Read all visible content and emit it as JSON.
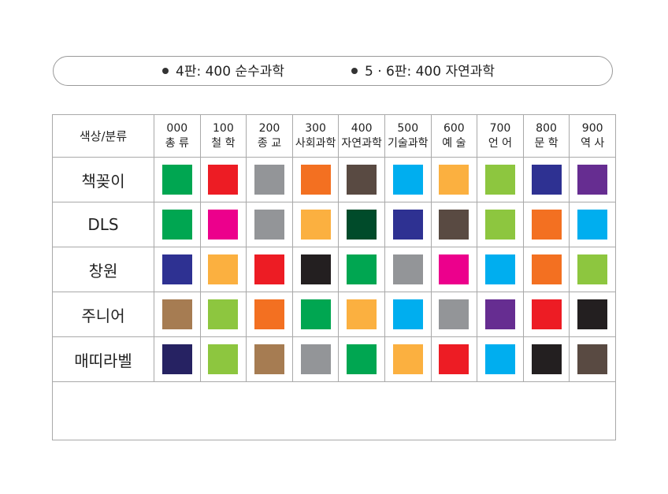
{
  "notes": [
    {
      "text": "4판: 400 순수과학"
    },
    {
      "text": "5 · 6판: 400 자연과학"
    }
  ],
  "table": {
    "corner_label": "색상/분류",
    "classes": [
      {
        "code": "000",
        "name": "총 류"
      },
      {
        "code": "100",
        "name": "철 학"
      },
      {
        "code": "200",
        "name": "종 교"
      },
      {
        "code": "300",
        "name": "사회과학"
      },
      {
        "code": "400",
        "name": "자연과학"
      },
      {
        "code": "500",
        "name": "기술과학"
      },
      {
        "code": "600",
        "name": "예 술"
      },
      {
        "code": "700",
        "name": "언 어"
      },
      {
        "code": "800",
        "name": "문 학"
      },
      {
        "code": "900",
        "name": "역 사"
      }
    ],
    "rows": [
      {
        "label": "책꽂이",
        "colors": [
          "#00A651",
          "#ED1C24",
          "#939598",
          "#F37021",
          "#594A42",
          "#00AEEF",
          "#FBB040",
          "#8DC63F",
          "#2E3192",
          "#662D91"
        ]
      },
      {
        "label": "DLS",
        "colors": [
          "#00A651",
          "#EC008C",
          "#939598",
          "#FBB040",
          "#004B2A",
          "#2E3192",
          "#594A42",
          "#8DC63F",
          "#F37021",
          "#00AEEF"
        ]
      },
      {
        "label": "창원",
        "colors": [
          "#2E3192",
          "#FBB040",
          "#ED1C24",
          "#231F20",
          "#00A651",
          "#939598",
          "#EC008C",
          "#00AEEF",
          "#F37021",
          "#8DC63F"
        ]
      },
      {
        "label": "주니어",
        "colors": [
          "#A67C52",
          "#8DC63F",
          "#F37021",
          "#00A651",
          "#FBB040",
          "#00AEEF",
          "#939598",
          "#662D91",
          "#ED1C24",
          "#231F20"
        ]
      },
      {
        "label": "매띠라벨",
        "colors": [
          "#262262",
          "#8DC63F",
          "#A67C52",
          "#939598",
          "#00A651",
          "#FBB040",
          "#ED1C24",
          "#00AEEF",
          "#231F20",
          "#594A42"
        ]
      }
    ]
  }
}
